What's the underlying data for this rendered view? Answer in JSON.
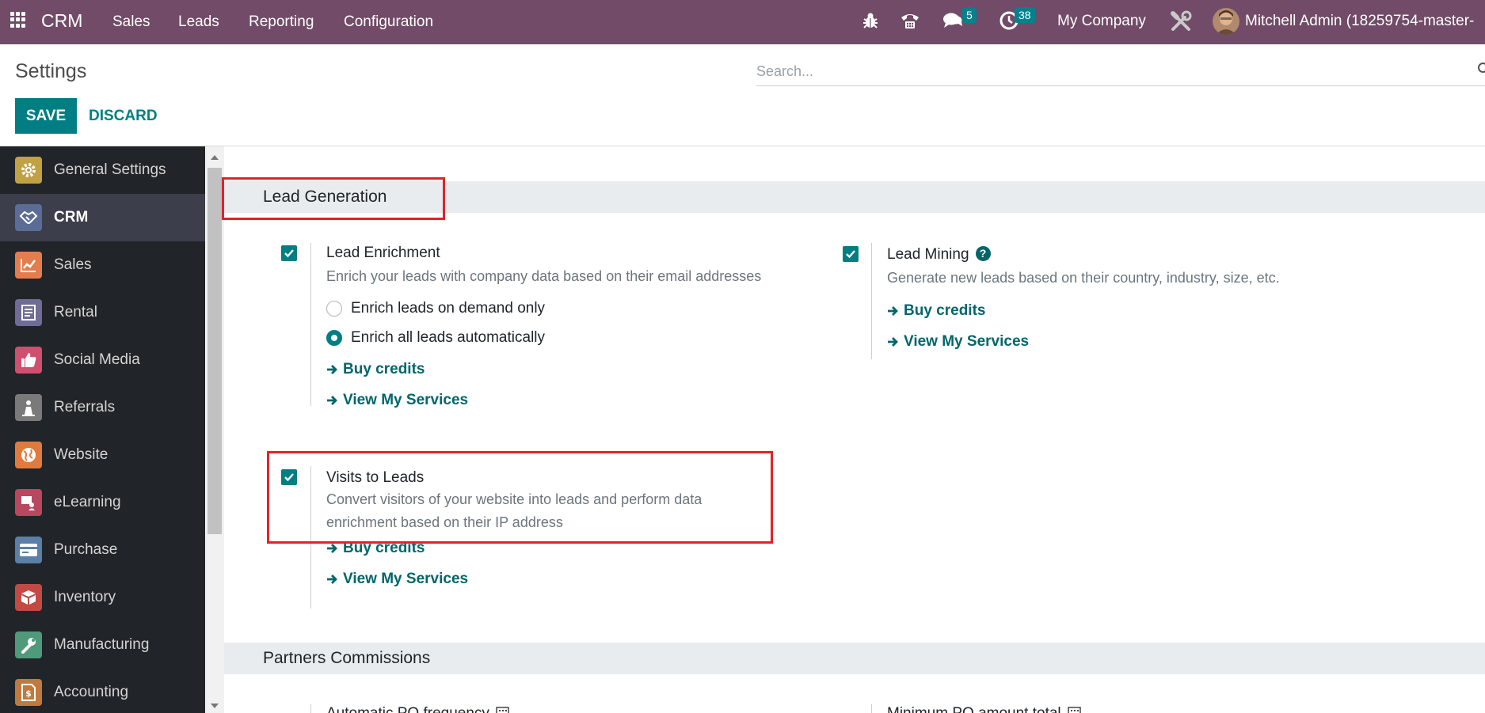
{
  "navbar": {
    "brand": "CRM",
    "menus": [
      "Sales",
      "Leads",
      "Reporting",
      "Configuration"
    ],
    "messages_count": "5",
    "activities_count": "38",
    "company": "My Company",
    "user": "Mitchell Admin (18259754-master-"
  },
  "control_panel": {
    "title": "Settings",
    "search_placeholder": "Search...",
    "save_label": "SAVE",
    "discard_label": "DISCARD"
  },
  "sidebar": {
    "items": [
      {
        "label": "General Settings",
        "icon": "gear-icon",
        "color": "#c0a144"
      },
      {
        "label": "CRM",
        "icon": "handshake-icon",
        "color": "#5b6d96"
      },
      {
        "label": "Sales",
        "icon": "chart-icon",
        "color": "#e47d4e"
      },
      {
        "label": "Rental",
        "icon": "rental-icon",
        "color": "#6f6d96"
      },
      {
        "label": "Social Media",
        "icon": "thumbs-up-icon",
        "color": "#d14f6e"
      },
      {
        "label": "Referrals",
        "icon": "referrals-icon",
        "color": "#7a7a7a"
      },
      {
        "label": "Website",
        "icon": "globe-icon",
        "color": "#e07b3d"
      },
      {
        "label": "eLearning",
        "icon": "elearning-icon",
        "color": "#b9475f"
      },
      {
        "label": "Purchase",
        "icon": "card-icon",
        "color": "#5b7fa6"
      },
      {
        "label": "Inventory",
        "icon": "box-icon",
        "color": "#c34a43"
      },
      {
        "label": "Manufacturing",
        "icon": "wrench-icon",
        "color": "#4e9a7a"
      },
      {
        "label": "Accounting",
        "icon": "invoice-icon",
        "color": "#c17a3b"
      }
    ]
  },
  "lead_generation": {
    "title": "Lead Generation",
    "lead_enrichment": {
      "title": "Lead Enrichment",
      "description": "Enrich your leads with company data based on their email addresses",
      "option_demand": "Enrich leads on demand only",
      "option_auto": "Enrich all leads automatically",
      "buy_credits": "Buy credits",
      "view_services": "View My Services"
    },
    "lead_mining": {
      "title": "Lead Mining",
      "description": "Generate new leads based on their country, industry, size, etc.",
      "buy_credits": "Buy credits",
      "view_services": "View My Services"
    },
    "visits_to_leads": {
      "title": "Visits to Leads",
      "description": "Convert visitors of your website into leads and perform data enrichment based on their IP address",
      "buy_credits": "Buy credits",
      "view_services": "View My Services"
    }
  },
  "partners_commissions": {
    "title": "Partners Commissions",
    "left_setting": "Automatic PO frequency",
    "right_setting": "Minimum PO amount total"
  }
}
